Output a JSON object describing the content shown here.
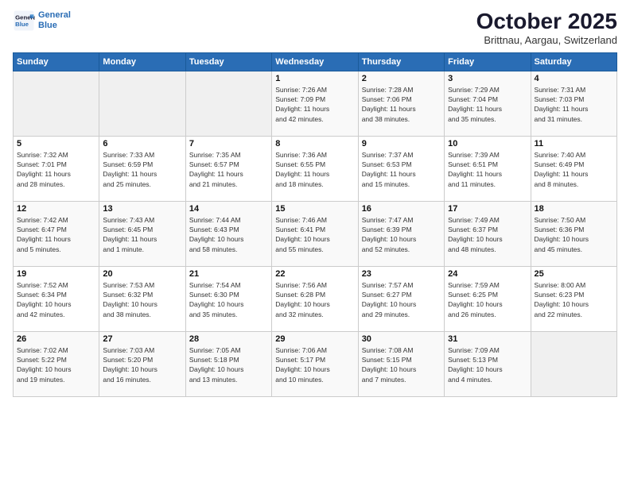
{
  "header": {
    "logo_line1": "General",
    "logo_line2": "Blue",
    "month": "October 2025",
    "location": "Brittnau, Aargau, Switzerland"
  },
  "weekdays": [
    "Sunday",
    "Monday",
    "Tuesday",
    "Wednesday",
    "Thursday",
    "Friday",
    "Saturday"
  ],
  "weeks": [
    [
      {
        "day": "",
        "info": ""
      },
      {
        "day": "",
        "info": ""
      },
      {
        "day": "",
        "info": ""
      },
      {
        "day": "1",
        "info": "Sunrise: 7:26 AM\nSunset: 7:09 PM\nDaylight: 11 hours\nand 42 minutes."
      },
      {
        "day": "2",
        "info": "Sunrise: 7:28 AM\nSunset: 7:06 PM\nDaylight: 11 hours\nand 38 minutes."
      },
      {
        "day": "3",
        "info": "Sunrise: 7:29 AM\nSunset: 7:04 PM\nDaylight: 11 hours\nand 35 minutes."
      },
      {
        "day": "4",
        "info": "Sunrise: 7:31 AM\nSunset: 7:03 PM\nDaylight: 11 hours\nand 31 minutes."
      }
    ],
    [
      {
        "day": "5",
        "info": "Sunrise: 7:32 AM\nSunset: 7:01 PM\nDaylight: 11 hours\nand 28 minutes."
      },
      {
        "day": "6",
        "info": "Sunrise: 7:33 AM\nSunset: 6:59 PM\nDaylight: 11 hours\nand 25 minutes."
      },
      {
        "day": "7",
        "info": "Sunrise: 7:35 AM\nSunset: 6:57 PM\nDaylight: 11 hours\nand 21 minutes."
      },
      {
        "day": "8",
        "info": "Sunrise: 7:36 AM\nSunset: 6:55 PM\nDaylight: 11 hours\nand 18 minutes."
      },
      {
        "day": "9",
        "info": "Sunrise: 7:37 AM\nSunset: 6:53 PM\nDaylight: 11 hours\nand 15 minutes."
      },
      {
        "day": "10",
        "info": "Sunrise: 7:39 AM\nSunset: 6:51 PM\nDaylight: 11 hours\nand 11 minutes."
      },
      {
        "day": "11",
        "info": "Sunrise: 7:40 AM\nSunset: 6:49 PM\nDaylight: 11 hours\nand 8 minutes."
      }
    ],
    [
      {
        "day": "12",
        "info": "Sunrise: 7:42 AM\nSunset: 6:47 PM\nDaylight: 11 hours\nand 5 minutes."
      },
      {
        "day": "13",
        "info": "Sunrise: 7:43 AM\nSunset: 6:45 PM\nDaylight: 11 hours\nand 1 minute."
      },
      {
        "day": "14",
        "info": "Sunrise: 7:44 AM\nSunset: 6:43 PM\nDaylight: 10 hours\nand 58 minutes."
      },
      {
        "day": "15",
        "info": "Sunrise: 7:46 AM\nSunset: 6:41 PM\nDaylight: 10 hours\nand 55 minutes."
      },
      {
        "day": "16",
        "info": "Sunrise: 7:47 AM\nSunset: 6:39 PM\nDaylight: 10 hours\nand 52 minutes."
      },
      {
        "day": "17",
        "info": "Sunrise: 7:49 AM\nSunset: 6:37 PM\nDaylight: 10 hours\nand 48 minutes."
      },
      {
        "day": "18",
        "info": "Sunrise: 7:50 AM\nSunset: 6:36 PM\nDaylight: 10 hours\nand 45 minutes."
      }
    ],
    [
      {
        "day": "19",
        "info": "Sunrise: 7:52 AM\nSunset: 6:34 PM\nDaylight: 10 hours\nand 42 minutes."
      },
      {
        "day": "20",
        "info": "Sunrise: 7:53 AM\nSunset: 6:32 PM\nDaylight: 10 hours\nand 38 minutes."
      },
      {
        "day": "21",
        "info": "Sunrise: 7:54 AM\nSunset: 6:30 PM\nDaylight: 10 hours\nand 35 minutes."
      },
      {
        "day": "22",
        "info": "Sunrise: 7:56 AM\nSunset: 6:28 PM\nDaylight: 10 hours\nand 32 minutes."
      },
      {
        "day": "23",
        "info": "Sunrise: 7:57 AM\nSunset: 6:27 PM\nDaylight: 10 hours\nand 29 minutes."
      },
      {
        "day": "24",
        "info": "Sunrise: 7:59 AM\nSunset: 6:25 PM\nDaylight: 10 hours\nand 26 minutes."
      },
      {
        "day": "25",
        "info": "Sunrise: 8:00 AM\nSunset: 6:23 PM\nDaylight: 10 hours\nand 22 minutes."
      }
    ],
    [
      {
        "day": "26",
        "info": "Sunrise: 7:02 AM\nSunset: 5:22 PM\nDaylight: 10 hours\nand 19 minutes."
      },
      {
        "day": "27",
        "info": "Sunrise: 7:03 AM\nSunset: 5:20 PM\nDaylight: 10 hours\nand 16 minutes."
      },
      {
        "day": "28",
        "info": "Sunrise: 7:05 AM\nSunset: 5:18 PM\nDaylight: 10 hours\nand 13 minutes."
      },
      {
        "day": "29",
        "info": "Sunrise: 7:06 AM\nSunset: 5:17 PM\nDaylight: 10 hours\nand 10 minutes."
      },
      {
        "day": "30",
        "info": "Sunrise: 7:08 AM\nSunset: 5:15 PM\nDaylight: 10 hours\nand 7 minutes."
      },
      {
        "day": "31",
        "info": "Sunrise: 7:09 AM\nSunset: 5:13 PM\nDaylight: 10 hours\nand 4 minutes."
      },
      {
        "day": "",
        "info": ""
      }
    ]
  ]
}
